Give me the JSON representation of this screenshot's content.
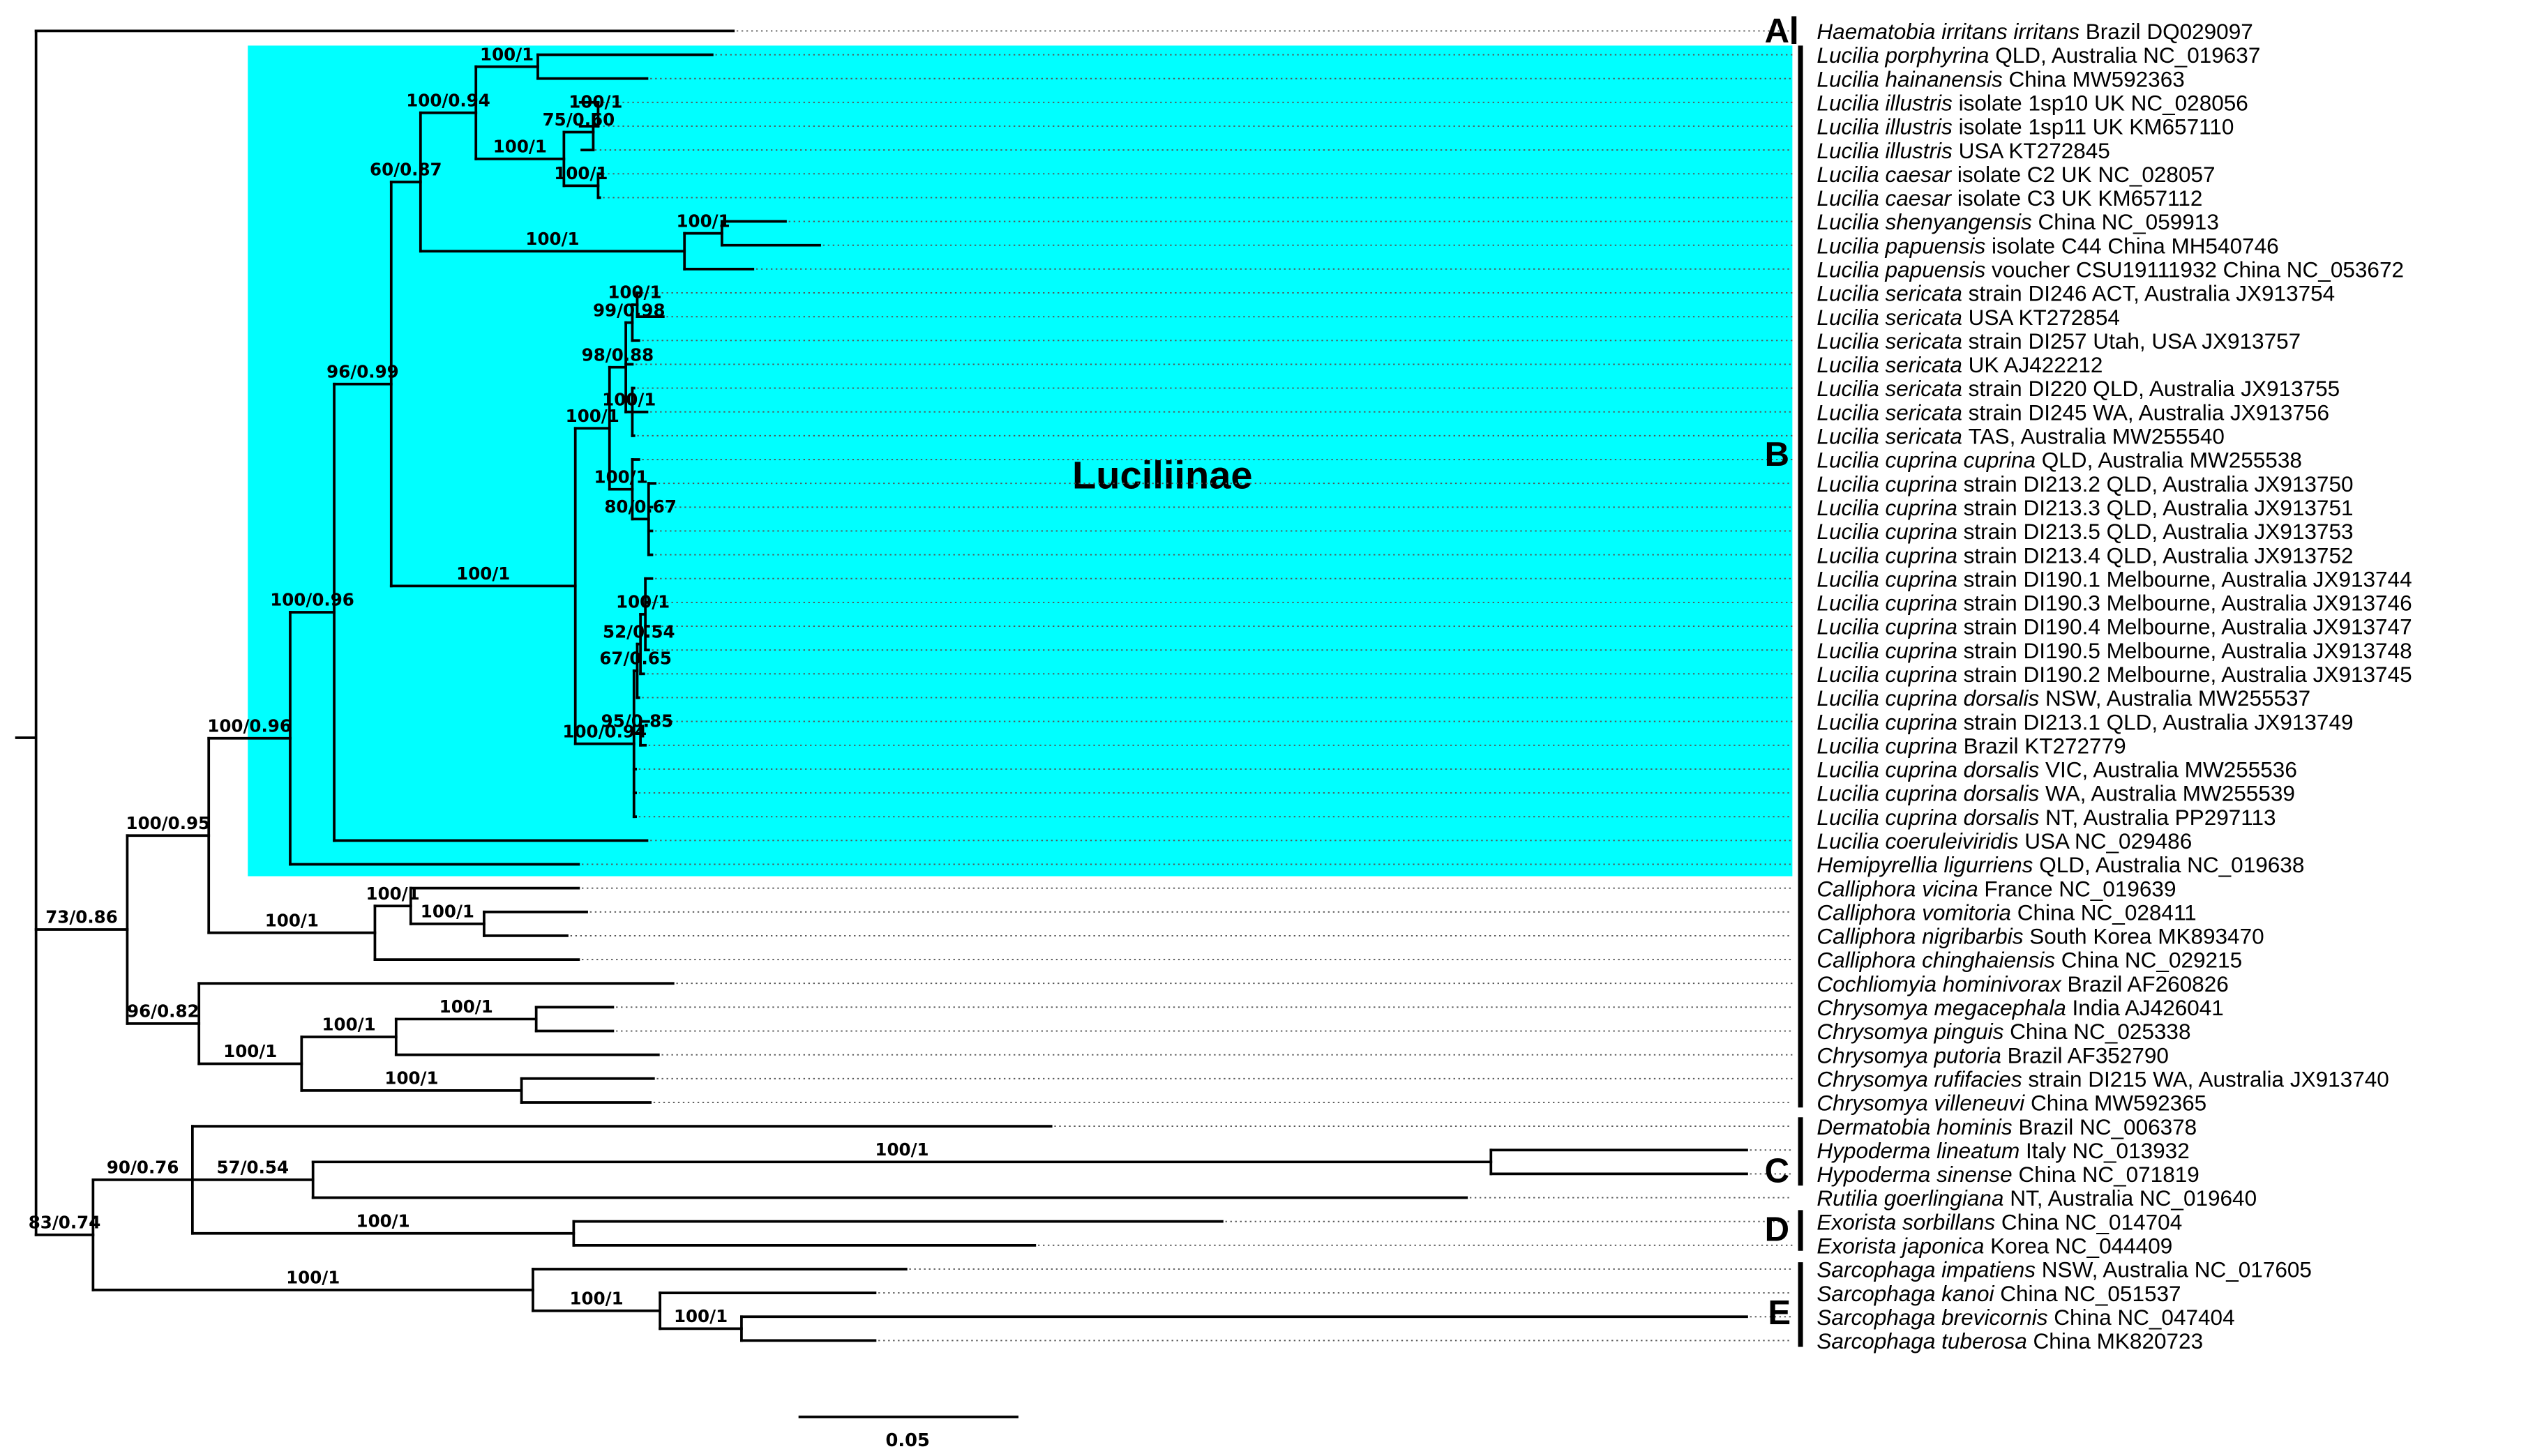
{
  "taxa": [
    {
      "species": "Haematobia irritans irritans",
      "details": "Brazil DQ029097"
    },
    {
      "species": "Lucilia porphyrina",
      "details": "QLD, Australia NC_019637"
    },
    {
      "species": "Lucilia hainanensis",
      "details": "China MW592363"
    },
    {
      "species": "Lucilia illustris",
      "details": "isolate 1sp10 UK NC_028056"
    },
    {
      "species": "Lucilia illustris",
      "details": "isolate 1sp11 UK KM657110"
    },
    {
      "species": "Lucilia illustris",
      "details": "USA KT272845"
    },
    {
      "species": "Lucilia caesar",
      "details": "isolate C2 UK NC_028057"
    },
    {
      "species": "Lucilia caesar",
      "details": "isolate C3 UK KM657112"
    },
    {
      "species": "Lucilia shenyangensis",
      "details": "China NC_059913"
    },
    {
      "species": "Lucilia papuensis",
      "details": "isolate C44 China MH540746"
    },
    {
      "species": "Lucilia papuensis",
      "details": "voucher CSU19111932 China NC_053672"
    },
    {
      "species": "Lucilia sericata",
      "details": "strain DI246 ACT, Australia JX913754"
    },
    {
      "species": "Lucilia sericata",
      "details": "USA KT272854"
    },
    {
      "species": "Lucilia sericata",
      "details": "strain DI257 Utah, USA JX913757"
    },
    {
      "species": "Lucilia sericata",
      "details": "UK AJ422212"
    },
    {
      "species": "Lucilia sericata",
      "details": "strain DI220 QLD, Australia JX913755"
    },
    {
      "species": "Lucilia sericata",
      "details": "strain DI245 WA, Australia JX913756"
    },
    {
      "species": "Lucilia sericata",
      "details": "TAS, Australia MW255540"
    },
    {
      "species": "Lucilia cuprina cuprina",
      "details": "QLD, Australia MW255538"
    },
    {
      "species": "Lucilia cuprina",
      "details": "strain DI213.2 QLD, Australia JX913750"
    },
    {
      "species": "Lucilia cuprina",
      "details": "strain DI213.3 QLD, Australia JX913751"
    },
    {
      "species": "Lucilia cuprina",
      "details": "strain DI213.5 QLD, Australia JX913753"
    },
    {
      "species": "Lucilia cuprina",
      "details": "strain DI213.4 QLD, Australia JX913752"
    },
    {
      "species": "Lucilia cuprina",
      "details": "strain DI190.1 Melbourne, Australia JX913744"
    },
    {
      "species": "Lucilia cuprina",
      "details": "strain DI190.3 Melbourne, Australia JX913746"
    },
    {
      "species": "Lucilia cuprina",
      "details": "strain DI190.4 Melbourne, Australia JX913747"
    },
    {
      "species": "Lucilia cuprina",
      "details": "strain DI190.5 Melbourne, Australia JX913748"
    },
    {
      "species": "Lucilia cuprina",
      "details": "strain DI190.2 Melbourne, Australia JX913745"
    },
    {
      "species": "Lucilia cuprina dorsalis",
      "details": "NSW, Australia MW255537"
    },
    {
      "species": "Lucilia cuprina",
      "details": "strain DI213.1 QLD, Australia JX913749"
    },
    {
      "species": "Lucilia cuprina",
      "details": "Brazil KT272779"
    },
    {
      "species": "Lucilia cuprina dorsalis",
      "details": "VIC, Australia MW255536"
    },
    {
      "species": "Lucilia cuprina dorsalis",
      "details": "WA, Australia MW255539"
    },
    {
      "species": "Lucilia cuprina dorsalis",
      "details": "NT, Australia PP297113",
      "highlight": true
    },
    {
      "species": "Lucilia coeruleiviridis",
      "details": "USA NC_029486"
    },
    {
      "species": "Hemipyrellia ligurriens",
      "details": "QLD, Australia NC_019638"
    },
    {
      "species": "Calliphora vicina",
      "details": "France NC_019639"
    },
    {
      "species": "Calliphora vomitoria",
      "details": "China NC_028411"
    },
    {
      "species": "Calliphora nigribarbis",
      "details": "South Korea MK893470"
    },
    {
      "species": "Calliphora chinghaiensis",
      "details": "China NC_029215"
    },
    {
      "species": "Cochliomyia hominivorax",
      "details": "Brazil AF260826"
    },
    {
      "species": "Chrysomya megacephala",
      "details": "India AJ426041"
    },
    {
      "species": "Chrysomya pinguis",
      "details": "China NC_025338"
    },
    {
      "species": "Chrysomya putoria",
      "details": "Brazil AF352790"
    },
    {
      "species": "Chrysomya rufifacies",
      "details": "strain DI215 WA, Australia JX913740"
    },
    {
      "species": "Chrysomya villeneuvi",
      "details": "China MW592365"
    },
    {
      "species": "Dermatobia hominis",
      "details": "Brazil NC_006378"
    },
    {
      "species": "Hypoderma lineatum",
      "details": "Italy NC_013932"
    },
    {
      "species": "Hypoderma sinense",
      "details": "China NC_071819"
    },
    {
      "species": "Rutilia goerlingiana",
      "details": "NT, Australia NC_019640"
    },
    {
      "species": "Exorista sorbillans",
      "details": "China NC_014704"
    },
    {
      "species": "Exorista japonica",
      "details": "Korea NC_044409"
    },
    {
      "species": "Sarcophaga impatiens",
      "details": "NSW, Australia NC_017605"
    },
    {
      "species": "Sarcophaga kanoi",
      "details": "China NC_051537"
    },
    {
      "species": "Sarcophaga brevicornis",
      "details": "China NC_047404"
    },
    {
      "species": "Sarcophaga tuberosa",
      "details": "China MK820723"
    }
  ],
  "highlight_color": "#ff0000",
  "supports": [
    "100/1",
    "100/0.94",
    "100/1",
    "100/1",
    "75/0.60",
    "100/1",
    "60/0.87",
    "100/1",
    "100/1",
    "96/0.99",
    "100/0.96",
    "100/0.96",
    "100/0.95",
    "73/0.86",
    "99/0.98",
    "100/1",
    "100/1",
    "98/0.88",
    "100/1",
    "100/1",
    "80/0.67",
    "52/0.54",
    "100/1",
    "67/0.65",
    "95/0.85",
    "100/0.94",
    "100/1",
    "100/1",
    "100/1",
    "100/1",
    "96/0.82",
    "100/1",
    "100/1",
    "100/1",
    "100/1",
    "90/0.76",
    "57/0.54",
    "100/1",
    "100/1",
    "100/1",
    "100/1",
    "100/1",
    "83/0.74"
  ],
  "clade_box": {
    "label": "Luciliinae",
    "color": "#00ffff"
  },
  "groups": [
    {
      "label": "A"
    },
    {
      "label": "B"
    },
    {
      "label": "C"
    },
    {
      "label": "D"
    },
    {
      "label": "E"
    }
  ],
  "scale_bar": {
    "label": "0.05"
  }
}
